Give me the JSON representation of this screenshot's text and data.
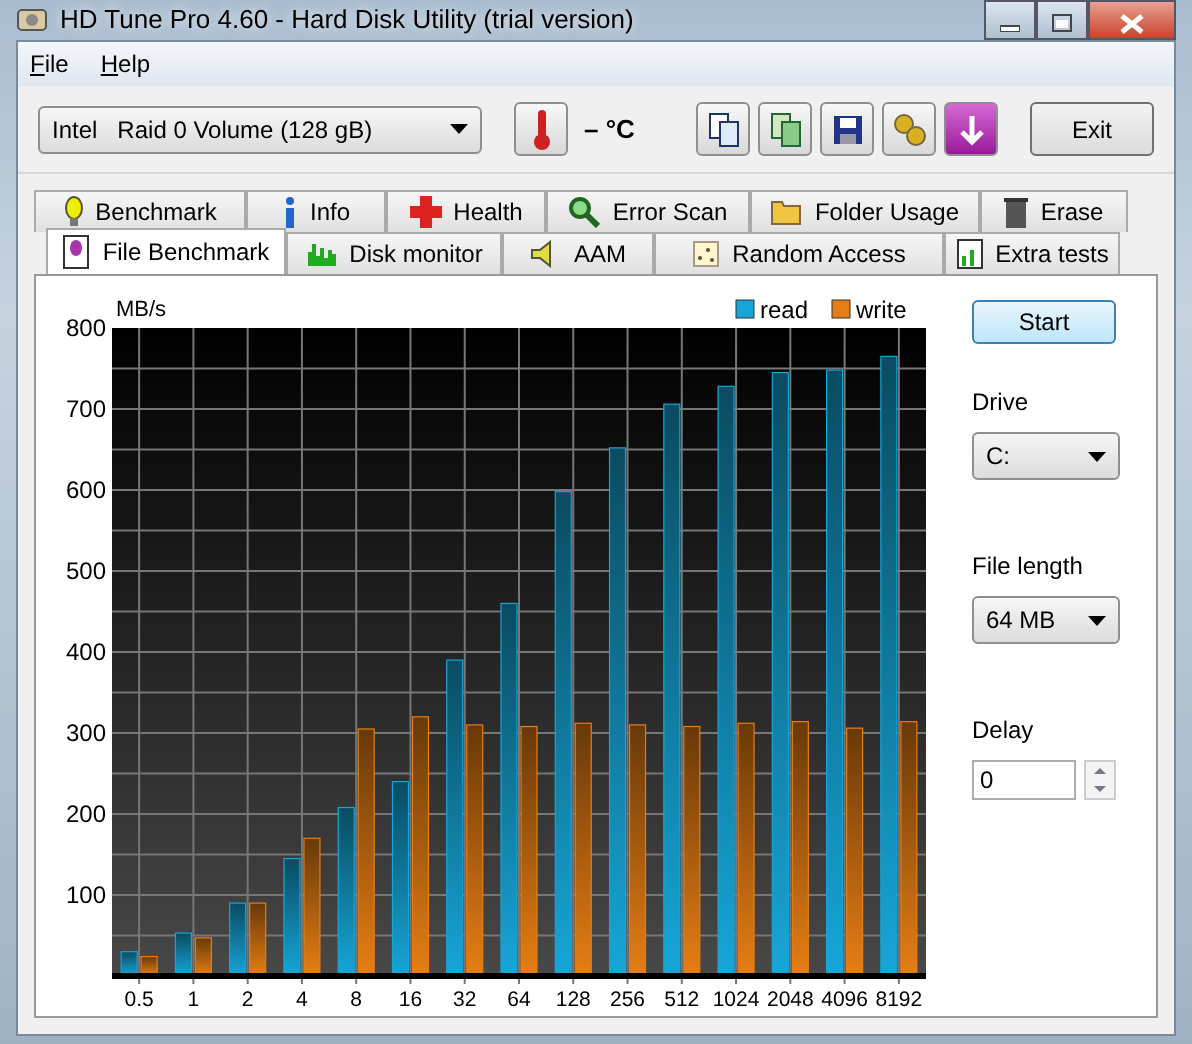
{
  "window": {
    "title": "HD Tune Pro 4.60 - Hard Disk Utility (trial version)"
  },
  "menu": [
    "File",
    "Help"
  ],
  "toolbar": {
    "drive": "Intel   Raid 0 Volume (128 gB)",
    "temperature": "– °C",
    "exit": "Exit"
  },
  "tab_rows": [
    [
      {
        "label": "Benchmark",
        "selected": false
      },
      {
        "label": "Info",
        "selected": false
      },
      {
        "label": "Health",
        "selected": false
      },
      {
        "label": "Error Scan",
        "selected": false
      },
      {
        "label": "Folder Usage",
        "selected": false
      },
      {
        "label": "Erase",
        "selected": false
      }
    ],
    [
      {
        "label": "File Benchmark",
        "selected": true
      },
      {
        "label": "Disk monitor",
        "selected": false
      },
      {
        "label": "AAM",
        "selected": false
      },
      {
        "label": "Random Access",
        "selected": false
      },
      {
        "label": "Extra tests",
        "selected": false
      }
    ]
  ],
  "panel": {
    "chart_data": {
      "type": "bar",
      "ylabel": "MB/s",
      "categories": [
        "0.5",
        "1",
        "2",
        "4",
        "8",
        "16",
        "32",
        "64",
        "128",
        "256",
        "512",
        "1024",
        "2048",
        "4096",
        "8192"
      ],
      "series": [
        {
          "name": "read",
          "color": "#17a6d8",
          "values": [
            30,
            53,
            90,
            145,
            208,
            240,
            390,
            460,
            598,
            652,
            706,
            728,
            745,
            748,
            765
          ]
        },
        {
          "name": "write",
          "color": "#e67e14",
          "values": [
            24,
            47,
            90,
            170,
            305,
            320,
            310,
            308,
            312,
            310,
            308,
            312,
            314,
            306,
            314
          ]
        }
      ],
      "grid": true,
      "legend": true,
      "ylim": [
        0,
        800
      ],
      "yticks": [
        100,
        200,
        300,
        400,
        500,
        600,
        700,
        800
      ]
    },
    "start": "Start",
    "drive_label": "Drive",
    "drive": "C:",
    "file_length_label": "File length",
    "file_length": "64 MB",
    "delay_label": "Delay",
    "delay": "0"
  }
}
